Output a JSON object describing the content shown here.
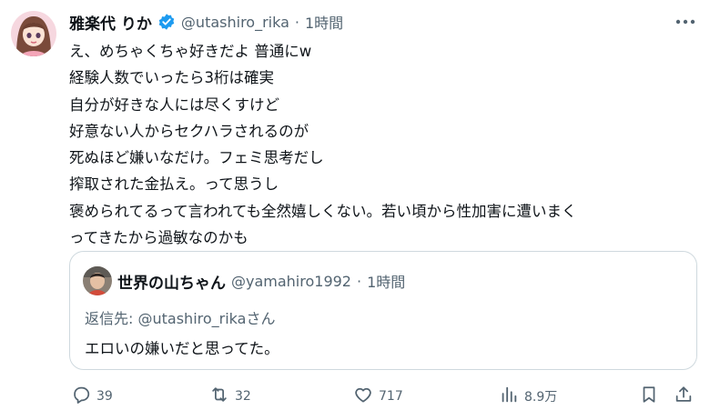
{
  "tweet": {
    "display_name": "雅楽代 りか",
    "handle": "@utashiro_rika",
    "separator": "·",
    "time": "1時間",
    "lines": [
      "え、めちゃくちゃ好きだよ 普通にw",
      "経験人数でいったら3桁は確実",
      "自分が好きな人には尽くすけど",
      "好意ない人からセクハラされるのが",
      "死ぬほど嫌いなだけ。フェミ思考だし",
      "搾取された金払え。って思うし",
      "褒められてるって言われても全然嬉しくない。若い頃から性加害に遭いまく",
      "ってきたから過敏なのかも"
    ]
  },
  "quote": {
    "display_name": "世界の山ちゃん",
    "handle": "@yamahiro1992",
    "separator": "·",
    "time": "1時間",
    "reply_label": "返信先:",
    "reply_to": "@utashiro_rikaさん",
    "text": "エロいの嫌いだと思ってた。"
  },
  "actions": {
    "reply_count": "39",
    "retweet_count": "32",
    "like_count": "717",
    "view_count": "8.9万"
  },
  "icons": {
    "verified": "verified-badge-icon",
    "more": "more-icon",
    "reply": "reply-icon",
    "retweet": "retweet-icon",
    "like": "heart-icon",
    "views": "views-chart-icon",
    "bookmark": "bookmark-icon",
    "share": "share-icon"
  },
  "colors": {
    "text": "#0f1419",
    "secondary": "#536471",
    "border": "#cfd9de",
    "verified": "#1d9bf0"
  }
}
